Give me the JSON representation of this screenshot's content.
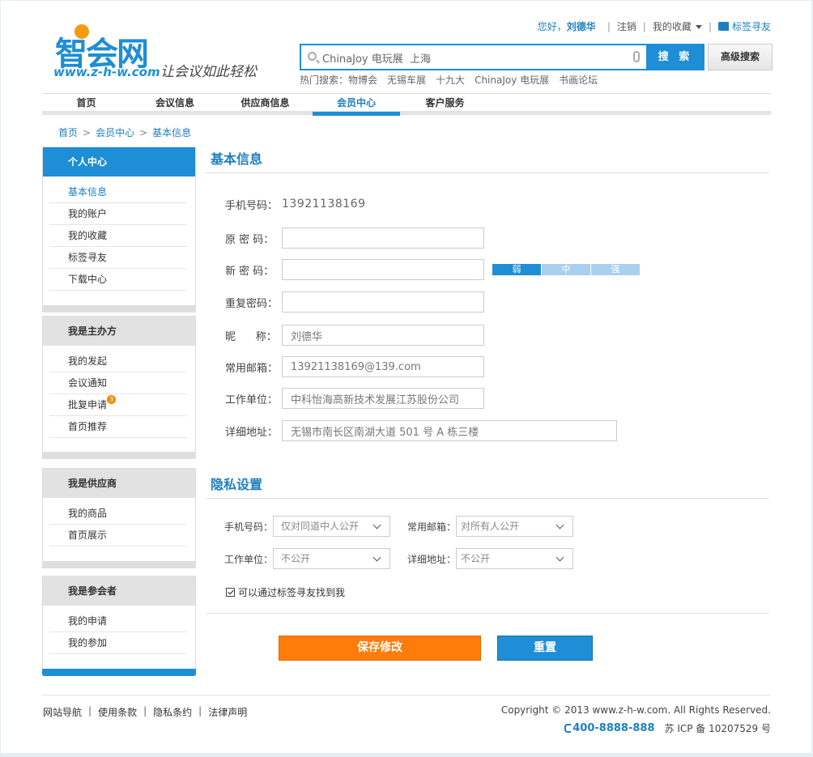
{
  "logo": {
    "mark": "智会网",
    "url": "www.z-h-w.com",
    "slogan": "让会议如此轻松"
  },
  "top": {
    "hello": "您好，",
    "username": "刘德华",
    "logout": "注销",
    "favorites": "我的收藏",
    "tag_friends": "标签寻友"
  },
  "search": {
    "value": "ChinaJoy 电玩展  上海",
    "button": "搜 索",
    "advanced": "高级搜索",
    "hot_label": "热门搜索：",
    "hot": [
      "物博会",
      "无锡车展",
      "十九大",
      "ChinaJoy 电玩展",
      "书画论坛"
    ]
  },
  "nav": [
    "首页",
    "会议信息",
    "供应商信息",
    "会员中心",
    "客户服务"
  ],
  "breadcrumb": [
    "首页",
    "会员中心",
    "基本信息"
  ],
  "sidebar": {
    "personal": {
      "title": "个人中心",
      "items": [
        "基本信息",
        "我的账户",
        "我的收藏",
        "标签寻友",
        "下载中心"
      ]
    },
    "organizer": {
      "title": "我是主办方",
      "items": [
        "我的发起",
        "会议通知",
        "批复申请",
        "首页推荐"
      ],
      "badge": "3"
    },
    "supplier": {
      "title": "我是供应商",
      "items": [
        "我的商品",
        "首页展示"
      ]
    },
    "attendee": {
      "title": "我是参会者",
      "items": [
        "我的申请",
        "我的参加"
      ]
    }
  },
  "basic": {
    "title": "基本信息",
    "phone_label": "手机号码：",
    "phone": "13921138169",
    "old_pwd_label": "原 密 码：",
    "new_pwd_label": "新 密 码：",
    "repeat_pwd_label": "重复密码：",
    "nick_label": "昵      称：",
    "nick": "刘德华",
    "email_label": "常用邮箱：",
    "email": "13921138169@139.com",
    "company_label": "工作单位：",
    "company": "中科怡海高新技术发展江苏股份公司",
    "address_label": "详细地址：",
    "address": "无锡市南长区南湖大道 501 号 A 栋三楼",
    "strength": [
      "弱",
      "中",
      "强"
    ]
  },
  "privacy": {
    "title": "隐私设置",
    "phone_label": "手机号码：",
    "phone_value": "仅对同道中人公开",
    "email_label": "常用邮箱：",
    "email_value": "对所有人公开",
    "company_label": "工作单位：",
    "company_value": "不公开",
    "address_label": "详细地址：",
    "address_value": "不公开",
    "checkbox": "可以通过标签寻友找到我"
  },
  "actions": {
    "save": "保存修改",
    "reset": "重置"
  },
  "footer": {
    "links": [
      "网站导航",
      "使用条款",
      "隐私条约",
      "法律声明"
    ],
    "copyright": "Copyright © 2013 www.z-h-w.com. All Rights Reserved.",
    "hotline": "400-8888-888",
    "icp": "苏 ICP 备 10207529 号"
  },
  "colors": {
    "accent": "#1e8ed6",
    "orange": "#ff7c0a",
    "strength_weak": "#1e8ed6",
    "strength_inactive": "#a9d0ee"
  }
}
